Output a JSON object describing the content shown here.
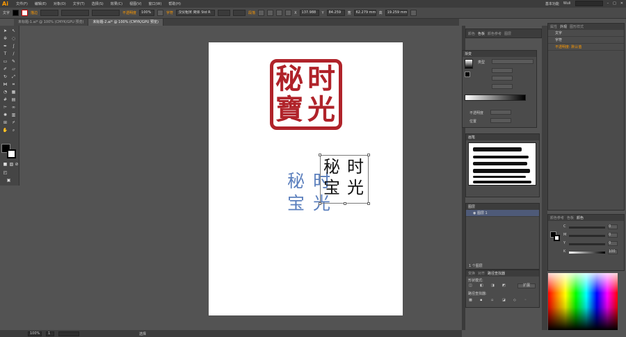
{
  "app": {
    "logo": "Ai"
  },
  "menu": [
    "文件(F)",
    "编辑(E)",
    "对象(O)",
    "文字(T)",
    "选择(S)",
    "效果(C)",
    "视图(V)",
    "窗口(W)",
    "帮助(H)"
  ],
  "menubar_right": {
    "workspace": "基本功能",
    "user": "Wuli"
  },
  "control": {
    "selection_label": "文字",
    "stroke_label": "描边",
    "opacity_label": "不透明度",
    "opacity_value": "100%",
    "char_label": "字符",
    "font_value": "汉仪粗宋 简体 Std R",
    "paragraph_label": "段落",
    "x_value": "137.988",
    "y_value": "84.259",
    "w_value": "62.279 mm",
    "h_value": "19.259 mm"
  },
  "tabs": [
    {
      "label": "未标题-1.ai* @ 100% (CMYK/GPU 预览)",
      "active": false
    },
    {
      "label": "未标题-2.ai* @ 100% (CMYK/GPU 预览)",
      "active": true
    }
  ],
  "artboard": {
    "seal_chars": [
      "秘",
      "时",
      "寶",
      "光"
    ],
    "blue_chars": [
      "秘",
      "时",
      "宝",
      "光"
    ],
    "black_chars": [
      "秘",
      "时",
      "宝",
      "光"
    ]
  },
  "status": {
    "zoom": "100%",
    "page": "1",
    "mode": "选择"
  },
  "panels": {
    "top_tabs": [
      "颜色",
      "色板",
      "颜色参考",
      "图层"
    ],
    "gradient": {
      "title": "渐变",
      "type_label": "类型",
      "type_value": "",
      "opacity_label": "不透明度",
      "position_label": "位置"
    },
    "brushes": {
      "title": "画笔"
    },
    "layers_small": {
      "title": "图层",
      "count_label": "1 个图层",
      "layer_name": "图层 1"
    },
    "pathfinder": {
      "tabs": [
        "变换",
        "对齐",
        "路径查找器"
      ],
      "shape_modes": "形状模式:",
      "expand": "扩展",
      "pathfinders": "路径查找器:"
    },
    "layers_right": {
      "tabs": [
        "属性",
        "外观",
        "图形样式"
      ],
      "rows": [
        {
          "label": "文字",
          "sel": false
        },
        {
          "label": "字符",
          "sel": false
        },
        {
          "label": "不透明度: 默认值",
          "sel": false
        }
      ]
    },
    "color": {
      "tabs": [
        "颜色参考",
        "色板",
        "颜色"
      ],
      "channels": [
        {
          "label": "C",
          "value": "0"
        },
        {
          "label": "M",
          "value": "0"
        },
        {
          "label": "Y",
          "value": "0"
        },
        {
          "label": "K",
          "value": "100"
        }
      ]
    }
  },
  "colors": {
    "seal_red": "#b0232a",
    "blue_text": "#5b7fbd",
    "accent_orange": "#ff9a00"
  }
}
